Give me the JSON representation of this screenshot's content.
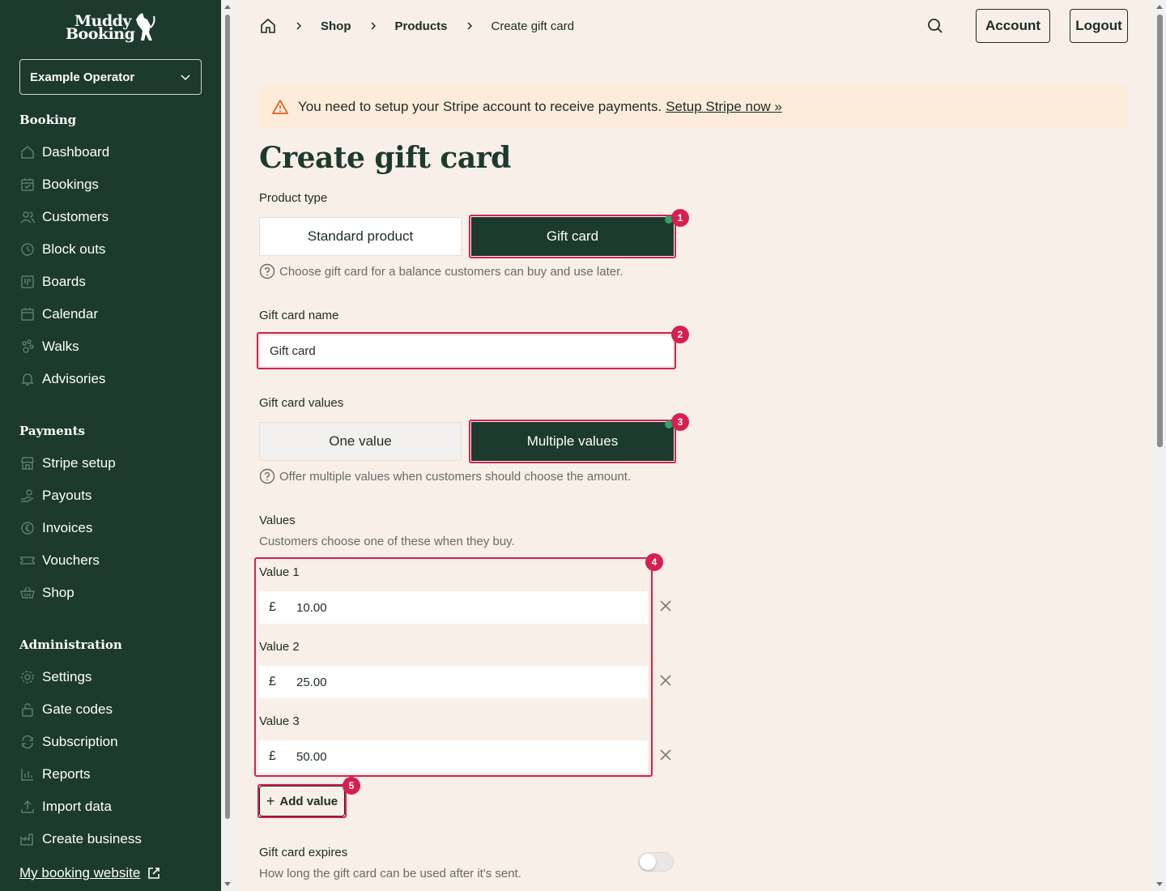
{
  "sidebar": {
    "logo_line1": "Muddy",
    "logo_line2": "Booking",
    "operator": "Example Operator",
    "sections": {
      "booking": "Booking",
      "payments": "Payments",
      "administration": "Administration"
    },
    "booking_items": [
      "Dashboard",
      "Bookings",
      "Customers",
      "Block outs",
      "Boards",
      "Calendar",
      "Walks",
      "Advisories"
    ],
    "payments_items": [
      "Stripe setup",
      "Payouts",
      "Invoices",
      "Vouchers",
      "Shop"
    ],
    "admin_items": [
      "Settings",
      "Gate codes",
      "Subscription",
      "Reports",
      "Import data",
      "Create business"
    ],
    "external_link": "My booking website"
  },
  "header": {
    "breadcrumb": [
      "Shop",
      "Products",
      "Create gift card"
    ],
    "account": "Account",
    "logout": "Logout"
  },
  "alert": {
    "message": "You need to setup your Stripe account to receive payments.",
    "link": "Setup Stripe now »"
  },
  "page": {
    "title": "Create gift card",
    "product_type_label": "Product type",
    "product_types": [
      "Standard product",
      "Gift card"
    ],
    "product_type_help": "Choose gift card for a balance customers can buy and use later.",
    "name_label": "Gift card name",
    "name_value": "Gift card",
    "values_mode_label": "Gift card values",
    "values_modes": [
      "One value",
      "Multiple values"
    ],
    "values_mode_help": "Offer multiple values when customers should choose the amount.",
    "values_label": "Values",
    "values_help": "Customers choose one of these when they buy.",
    "currency": "£",
    "values": [
      {
        "label": "Value 1",
        "amount": "10.00"
      },
      {
        "label": "Value 2",
        "amount": "25.00"
      },
      {
        "label": "Value 3",
        "amount": "50.00"
      }
    ],
    "add_value": "Add value",
    "expires_label": "Gift card expires",
    "expires_help": "How long the gift card can be used after it's sent."
  },
  "annotations": [
    "1",
    "2",
    "3",
    "4",
    "5"
  ],
  "colors": {
    "sidebar": "#1c3a2d",
    "background": "#f7efe8",
    "highlight": "#d6204f",
    "alert": "#fdecd9"
  }
}
